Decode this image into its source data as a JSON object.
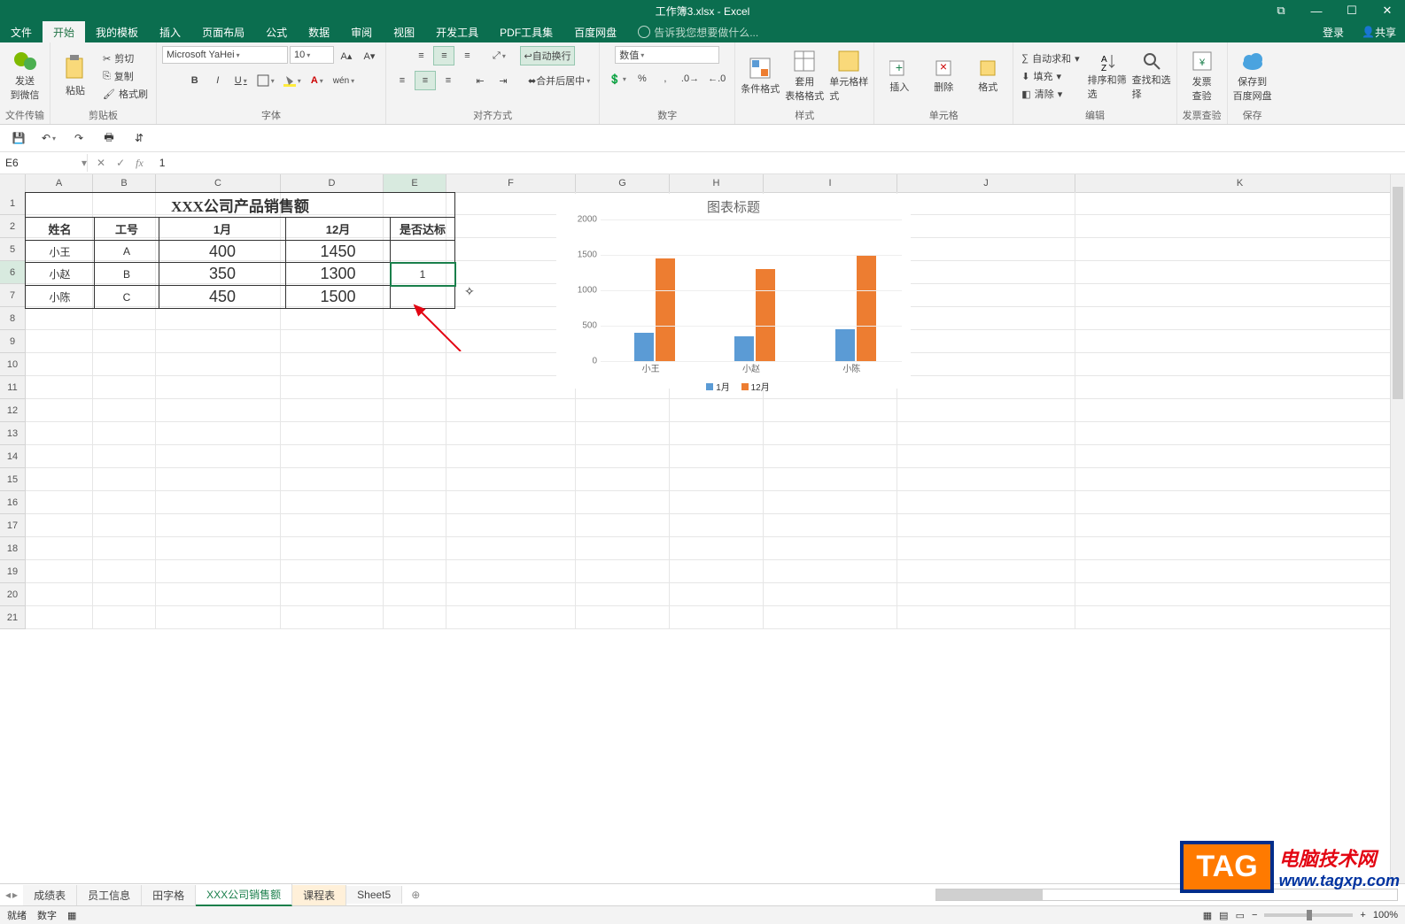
{
  "title_bar": {
    "title": "工作簿3.xlsx - Excel"
  },
  "window_buttons": {
    "restore_icon": "⧉",
    "minimize": "—",
    "maximize": "☐",
    "close": "✕"
  },
  "ribbon_tabs": {
    "file": "文件",
    "items": [
      "开始",
      "我的模板",
      "插入",
      "页面布局",
      "公式",
      "数据",
      "审阅",
      "视图",
      "开发工具",
      "PDF工具集",
      "百度网盘"
    ],
    "active": "开始",
    "tell_me": "告诉我您想要做什么...",
    "login": "登录",
    "share": "共享"
  },
  "ribbon": {
    "g_wechat": {
      "label": "发送\n到微信",
      "group": "文件传输"
    },
    "clipboard": {
      "paste": "粘贴",
      "cut": "剪切",
      "copy": "复制",
      "painter": "格式刷",
      "group": "剪贴板"
    },
    "font": {
      "name": "Microsoft YaHei",
      "size": "10",
      "group": "字体",
      "bold": "B",
      "italic": "I",
      "underline": "U"
    },
    "align": {
      "wrap": "自动换行",
      "merge": "合并后居中",
      "group": "对齐方式"
    },
    "number": {
      "format": "数值",
      "group": "数字"
    },
    "styles": {
      "cond": "条件格式",
      "table": "套用\n表格格式",
      "cell": "单元格样式",
      "group": "样式"
    },
    "cells": {
      "insert": "插入",
      "delete": "删除",
      "format": "格式",
      "group": "单元格"
    },
    "editing": {
      "sum": "自动求和",
      "fill": "填充",
      "clear": "清除",
      "sort": "排序和筛选",
      "find": "查找和选择",
      "group": "编辑"
    },
    "invoice": {
      "label": "发票\n查验",
      "group": "发票查验"
    },
    "baidu": {
      "label": "保存到\n百度网盘",
      "group": "保存"
    }
  },
  "qat": {
    "save": "💾",
    "undo": "↶",
    "redo": "↷"
  },
  "formula_bar": {
    "name_box": "E6",
    "value": "1"
  },
  "columns": {
    "A": 75,
    "B": 70,
    "C": 140,
    "D": 115,
    "E": 70,
    "F": 145,
    "G": 105,
    "H": 105,
    "I": 150,
    "J": 200,
    "K": 190
  },
  "visible_row_headers": [
    "1",
    "2",
    "5",
    "6",
    "7",
    "8",
    "9",
    "10",
    "11",
    "12",
    "13",
    "14",
    "15",
    "16",
    "17",
    "18",
    "19",
    "20",
    "21"
  ],
  "table": {
    "title": "XXX公司产品销售额",
    "headers": {
      "name": "姓名",
      "id": "工号",
      "m1": "1月",
      "m12": "12月",
      "pass": "是否达标"
    },
    "rows": [
      {
        "name": "小王",
        "id": "A",
        "m1": "400",
        "m12": "1450",
        "pass": ""
      },
      {
        "name": "小赵",
        "id": "B",
        "m1": "350",
        "m12": "1300",
        "pass": "1"
      },
      {
        "name": "小陈",
        "id": "C",
        "m1": "450",
        "m12": "1500",
        "pass": ""
      }
    ]
  },
  "chart_data": {
    "type": "bar",
    "title": "图表标题",
    "categories": [
      "小王",
      "小赵",
      "小陈"
    ],
    "series": [
      {
        "name": "1月",
        "values": [
          400,
          350,
          450
        ],
        "color": "#5b9bd5"
      },
      {
        "name": "12月",
        "values": [
          1450,
          1300,
          1500
        ],
        "color": "#ed7d31"
      }
    ],
    "yticks": [
      0,
      500,
      1000,
      1500,
      2000
    ],
    "ylim": [
      0,
      2000
    ]
  },
  "sheet_tabs": {
    "items": [
      "成绩表",
      "员工信息",
      "田字格",
      "XXX公司销售额",
      "课程表",
      "Sheet5"
    ],
    "active": "XXX公司销售额",
    "hover": "课程表"
  },
  "status_bar": {
    "ready": "就绪",
    "num": "数字",
    "zoom": "100%",
    "plus": "+",
    "minus": "−"
  },
  "watermark": {
    "tag": "TAG",
    "line1": "电脑技术网",
    "line2": "www.tagxp.com"
  }
}
